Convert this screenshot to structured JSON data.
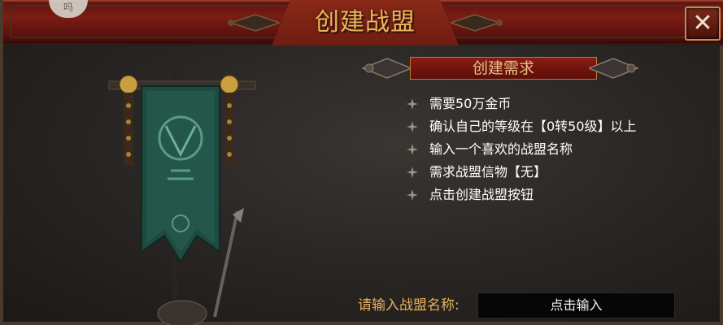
{
  "dialog": {
    "title": "创建战盟",
    "close_icon": "close-x-icon"
  },
  "corner_badge": {
    "text": "吗"
  },
  "requirements": {
    "header": "创建需求",
    "items": [
      {
        "text": "需要50万金币"
      },
      {
        "text": "确认自己的等级在【0转50级】以上"
      },
      {
        "text": "输入一个喜欢的战盟名称"
      },
      {
        "text": "需求战盟信物【无】"
      },
      {
        "text": "点击创建战盟按钮"
      }
    ]
  },
  "name_field": {
    "label": "请输入战盟名称:",
    "button_text": "点击输入"
  },
  "colors": {
    "title_bar": "#7a1c14",
    "title_text": "#e8b65c",
    "banner_green": "#1f4a40",
    "label_gold": "#e8b05a"
  }
}
